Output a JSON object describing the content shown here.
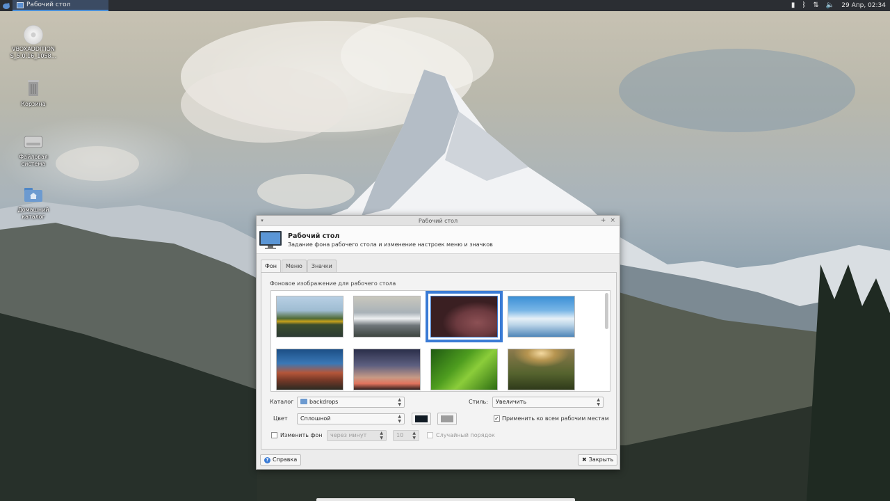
{
  "panel": {
    "task_title": "Рабочий стол",
    "datetime": "29 Апр, 02:34"
  },
  "desktop_icons": [
    {
      "label": "VBOXADDITION S_5.0.16_1058..."
    },
    {
      "label": "Корзина"
    },
    {
      "label": "Файловая система"
    },
    {
      "label": "Домашний каталог"
    }
  ],
  "dialog": {
    "title": "Рабочий стол",
    "header_title": "Рабочий стол",
    "header_subtitle": "Задание фона рабочего стола и изменение настроек меню и значков",
    "tabs": [
      {
        "label": "Фон",
        "active": true
      },
      {
        "label": "Меню",
        "active": false
      },
      {
        "label": "Значки",
        "active": false
      }
    ],
    "section_label": "Фоновое изображение для рабочего стола",
    "folder_label": "Каталог",
    "folder_value": "backdrops",
    "style_label": "Стиль:",
    "style_value": "Увеличить",
    "color_label": "Цвет",
    "color_value": "Сплошной",
    "primary_color": "#101a24",
    "secondary_color": "#9c9c9c",
    "apply_all_label": "Применить ко всем рабочим местам",
    "apply_all_checked": true,
    "change_bg_label": "Изменить фон",
    "change_bg_checked": false,
    "interval_unit": "через минут",
    "interval_value": "10",
    "random_order_label": "Случайный порядок",
    "random_order_checked": false,
    "help_button": "Справка",
    "close_button": "Закрыть"
  },
  "thumbnails_selected_index": 2,
  "accent_color": "#3a7bd5"
}
